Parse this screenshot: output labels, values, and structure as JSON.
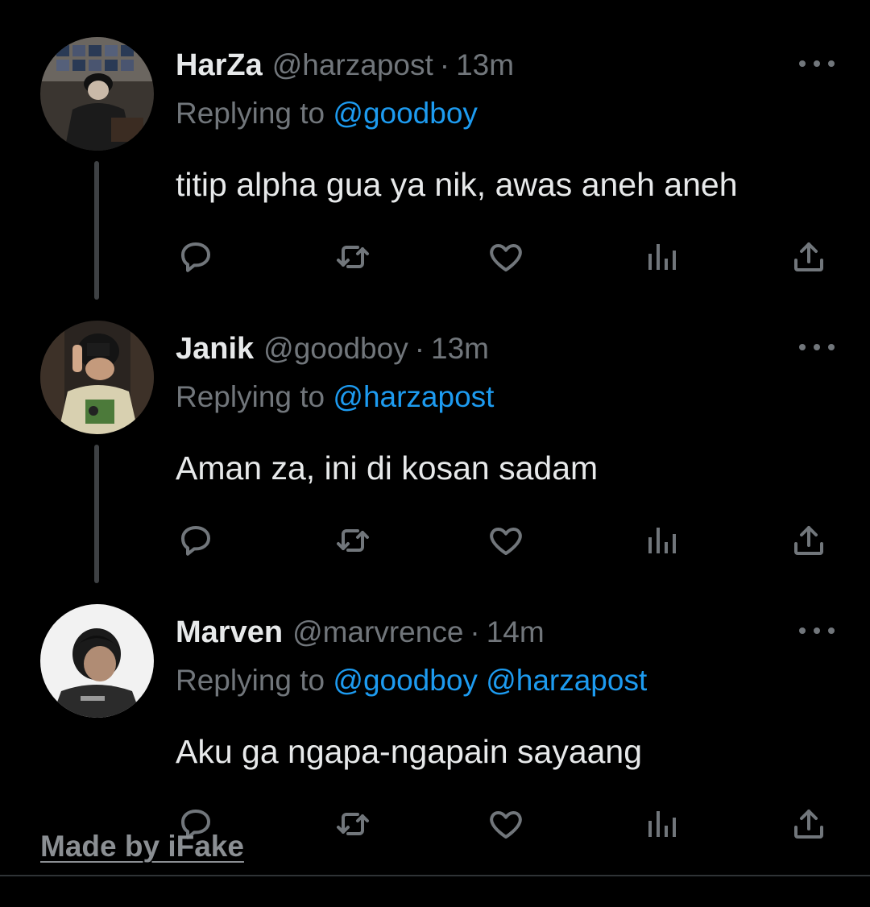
{
  "replying_prefix": "Replying to",
  "watermark": "Made by iFake",
  "icons": {
    "reply": "reply-icon",
    "retweet": "retweet-icon",
    "like": "heart-icon",
    "views": "views-icon",
    "share": "share-icon",
    "more": "more-icon"
  },
  "colors": {
    "background": "#000000",
    "mention": "#1d9bf0",
    "muted": "#71767b",
    "text": "#e7e9ea",
    "thread_line": "#3e4144"
  },
  "tweets": [
    {
      "name": "HarZa",
      "handle": "@harzapost",
      "separator": "·",
      "time": "13m",
      "mentions": "@goodboy",
      "text": "titip alpha gua ya nik, awas aneh aneh"
    },
    {
      "name": "Janik",
      "handle": "@goodboy",
      "separator": "·",
      "time": "13m",
      "mentions": "@harzapost",
      "text": "Aman za, ini di kosan sadam"
    },
    {
      "name": "Marven",
      "handle": "@marvrence",
      "separator": "·",
      "time": "14m",
      "mentions": "@goodboy @harzapost",
      "text": "Aku ga ngapa-ngapain sayaang"
    }
  ]
}
